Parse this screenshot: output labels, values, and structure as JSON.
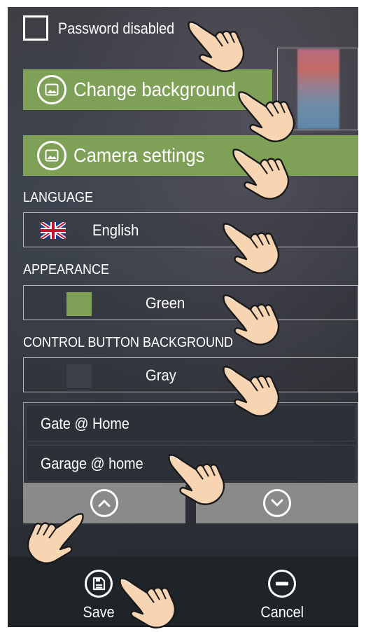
{
  "password": {
    "label": "Password disabled",
    "checked": false
  },
  "buttons": {
    "change_background": "Change background",
    "camera_settings": "Camera settings"
  },
  "language": {
    "title": "LANGUAGE",
    "value": "English",
    "flag_icon": "uk-flag-icon"
  },
  "appearance": {
    "title": "APPEARANCE",
    "value": "Green",
    "swatch_color": "#7ea157"
  },
  "control_background": {
    "title": "CONTROL BUTTON BACKGROUND",
    "value": "Gray",
    "swatch_color": "#3b4049"
  },
  "list": {
    "items": [
      {
        "label": "Gate @ Home"
      },
      {
        "label": "Garage @ home"
      }
    ]
  },
  "reorder": {
    "up_icon": "chevron-up-icon",
    "down_icon": "chevron-down-icon"
  },
  "bottom_bar": {
    "save_label": "Save",
    "cancel_label": "Cancel"
  },
  "colors": {
    "accent": "#7ea157",
    "bottom_bar": "#1f2429",
    "arrow_button": "#8a8a8a"
  }
}
